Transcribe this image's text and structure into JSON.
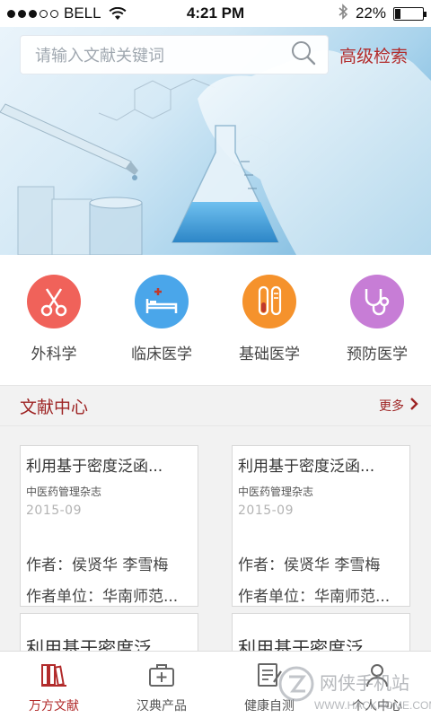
{
  "status_bar": {
    "carrier": "BELL",
    "time": "4:21 PM",
    "battery_percent": "22%",
    "battery_level": 0.22,
    "signal_bars_filled": 3,
    "signal_bars_total": 5
  },
  "search": {
    "placeholder": "请输入文献关键词",
    "advanced_label": "高级检索"
  },
  "categories": [
    {
      "label": "外科学",
      "icon": "scissors-icon",
      "color": "#f0625a"
    },
    {
      "label": "临床医学",
      "icon": "hospital-bed-icon",
      "color": "#4aa6ea"
    },
    {
      "label": "基础医学",
      "icon": "test-tubes-icon",
      "color": "#f5922c"
    },
    {
      "label": "预防医学",
      "icon": "stethoscope-icon",
      "color": "#c77dd6"
    }
  ],
  "section": {
    "title": "文献中心",
    "more_label": "更多"
  },
  "cards": [
    {
      "title": "利用基于密度泛函...",
      "journal": "中医药管理杂志",
      "date": "2015-09",
      "author": "作者：侯贤华  李雪梅",
      "org": "作者单位：华南师范..."
    },
    {
      "title": "利用基于密度泛函...",
      "journal": "中医药管理杂志",
      "date": "2015-09",
      "author": "作者：侯贤华  李雪梅",
      "org": "作者单位：华南师范..."
    },
    {
      "title": "利用基于密度泛"
    },
    {
      "title": "利用基于密度泛"
    }
  ],
  "tabs": [
    {
      "label": "万方文献",
      "icon": "books-icon",
      "active": true
    },
    {
      "label": "汉典产品",
      "icon": "medical-kit-icon",
      "active": false
    },
    {
      "label": "健康自测",
      "icon": "checklist-icon",
      "active": false
    },
    {
      "label": "个人中心",
      "icon": "person-icon",
      "active": false
    }
  ],
  "watermark": {
    "text": "网侠手机站",
    "url_text": "WWW.HACKHOME.COM"
  },
  "colors": {
    "accent": "#b22b2b",
    "section_title": "#9e2424"
  }
}
